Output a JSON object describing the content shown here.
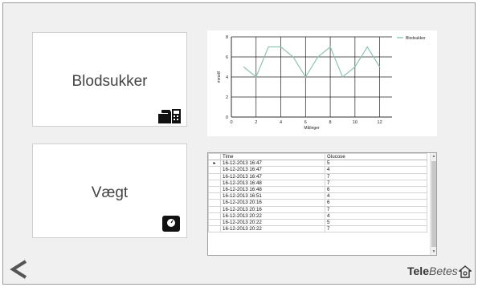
{
  "tiles": {
    "blood_sugar": {
      "label": "Blodsukker",
      "icon": "glucose-meter-icon"
    },
    "weight": {
      "label": "Vægt",
      "icon": "scale-icon"
    }
  },
  "chart_data": {
    "type": "line",
    "xlabel": "Målinger",
    "ylabel": "mmol/l",
    "xlim": [
      0,
      13
    ],
    "ylim": [
      0,
      8
    ],
    "x_ticks": [
      0,
      2,
      4,
      6,
      8,
      10,
      12
    ],
    "y_ticks": [
      0,
      2,
      4,
      6,
      8
    ],
    "grid": true,
    "legend_position": "top-right",
    "series": [
      {
        "name": "Blodsukker",
        "color": "#8fc4b4",
        "x": [
          1,
          2,
          3,
          4,
          5,
          6,
          7,
          8,
          9,
          10,
          11,
          12
        ],
        "y": [
          5,
          4,
          7,
          7,
          6,
          4,
          6,
          7,
          4,
          5,
          7,
          5
        ]
      }
    ]
  },
  "table": {
    "columns": [
      "Time",
      "Glucose"
    ],
    "rows": [
      [
        "16-12-2013 16:47",
        "5"
      ],
      [
        "16-12-2013 16:47",
        "4"
      ],
      [
        "16-12-2013 16:47",
        "7"
      ],
      [
        "16-12-2013 16:48",
        "7"
      ],
      [
        "16-12-2013 16:48",
        "6"
      ],
      [
        "16-12-2013 16:51",
        "4"
      ],
      [
        "16-12-2013 20:16",
        "6"
      ],
      [
        "16-12-2013 20:16",
        "7"
      ],
      [
        "16-12-2013 20:22",
        "4"
      ],
      [
        "16-12-2013 20:22",
        "5"
      ],
      [
        "16-12-2013 20:22",
        "7"
      ]
    ],
    "current_row_marker": "▸"
  },
  "nav": {
    "back_icon": "chevron-left-icon"
  },
  "brand": {
    "part1": "Tele",
    "part2": "Betes",
    "icon": "house-icon"
  }
}
